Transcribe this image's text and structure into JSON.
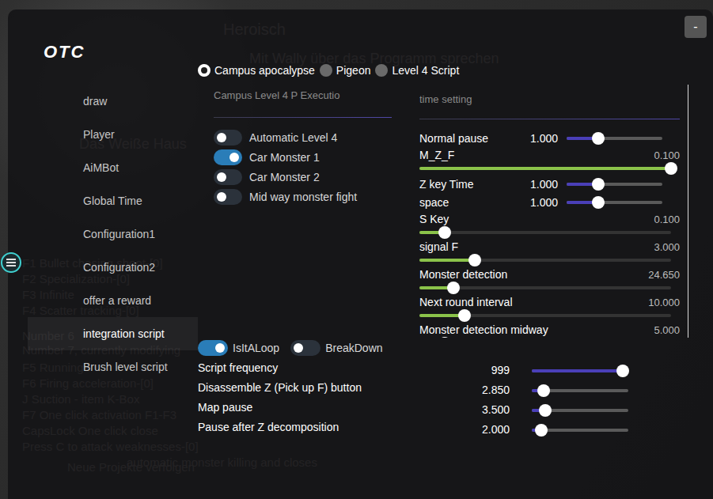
{
  "background": {
    "texts": [
      "Heroisch",
      "Mit Wally über das Programm sprechen",
      "Das Weiße Haus",
      "F1 Bullet chasing shoot-[0]",
      "F2 Specialization-[0]",
      "F3 Infinite",
      "F4 Scatter tracking-[0]",
      "Number 6",
      "Number 7, currently modifying",
      "F5 Running",
      "F6 Firing acceleration-[0]",
      "J Suction - item K-Box",
      "F7 One click activation F1-F3",
      "CapsLock One click close",
      "Press C to attack weaknesses-[0]",
      "automatic monster killing and closes",
      "Neue Projekte verfolgen"
    ]
  },
  "window": {
    "minimize_button": "-"
  },
  "logo": "OTC",
  "sidebar": {
    "items": [
      {
        "label": "draw",
        "selected": false
      },
      {
        "label": "Player",
        "selected": false
      },
      {
        "label": "AiMBot",
        "selected": false
      },
      {
        "label": "Global Time",
        "selected": false
      },
      {
        "label": "Configuration1",
        "selected": false
      },
      {
        "label": "Configuration2",
        "selected": false
      },
      {
        "label": "offer a reward",
        "selected": false
      },
      {
        "label": "integration script",
        "selected": true
      },
      {
        "label": "Brush level script",
        "selected": false
      }
    ]
  },
  "script_tabs": [
    {
      "label": "Campus apocalypse",
      "selected": true
    },
    {
      "label": "Pigeon",
      "selected": false
    },
    {
      "label": "Level 4 Script",
      "selected": false
    }
  ],
  "left_panel": {
    "title": "Campus Level 4 P Executio",
    "toggles": [
      {
        "label": "Automatic Level 4",
        "on": false
      },
      {
        "label": "Car Monster 1",
        "on": true
      },
      {
        "label": "Car Monster 2",
        "on": false
      },
      {
        "label": "Mid way monster fight",
        "on": false
      }
    ]
  },
  "right_panel": {
    "title": "time setting",
    "settings": [
      {
        "label": "Normal pause",
        "value": "1.000",
        "level": 0.33,
        "kind": "inline"
      },
      {
        "label": "M_Z_F",
        "value": "0.100",
        "level": 1.0,
        "kind": "stacked"
      },
      {
        "label": "Z key Time",
        "value": "1.000",
        "level": 0.33,
        "kind": "inline"
      },
      {
        "label": "space",
        "value": "1.000",
        "level": 0.33,
        "kind": "inline"
      },
      {
        "label": "S Key",
        "value": "0.100",
        "level": 0.1,
        "kind": "stacked"
      },
      {
        "label": "signal F",
        "value": "3.000",
        "level": 0.22,
        "kind": "stacked"
      },
      {
        "label": "Monster detection",
        "value": "24.650",
        "level": 0.135,
        "kind": "stacked"
      },
      {
        "label": "Next round interval",
        "value": "10.000",
        "level": 0.18,
        "kind": "stacked"
      },
      {
        "label": "Monster detection midway",
        "value": "5.000",
        "level": 0.1,
        "kind": "stacked"
      }
    ]
  },
  "bottom": {
    "toggles": [
      {
        "label": "IsItALoop",
        "on": true
      },
      {
        "label": "BreakDown",
        "on": false
      }
    ],
    "sliders": [
      {
        "label": "Script frequency",
        "value": "999",
        "level": 0.94
      },
      {
        "label": "Disassemble Z (Pick up F) button",
        "value": "2.850",
        "level": 0.12
      },
      {
        "label": "Map pause",
        "value": "3.500",
        "level": 0.14
      },
      {
        "label": "Pause after Z decomposition",
        "value": "2.000",
        "level": 0.1
      }
    ]
  }
}
